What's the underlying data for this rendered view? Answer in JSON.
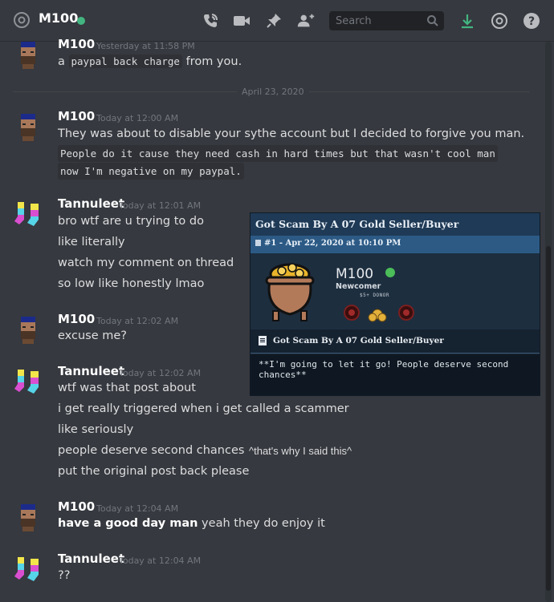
{
  "header": {
    "channel": "M100",
    "search_placeholder": "Search",
    "icons": [
      "at-sign-icon",
      "phone-call-icon",
      "video-call-icon",
      "pin-icon",
      "add-member-icon",
      "search-icon",
      "download-icon",
      "mentions-icon",
      "help-icon"
    ]
  },
  "divider": {
    "label": "April 23, 2020"
  },
  "messages": [
    {
      "author": "M100",
      "timestamp": "Yesterday at 11:58 PM",
      "lines": [
        "a ",
        "paypal back charge",
        " from you."
      ]
    },
    {
      "author": "M100",
      "timestamp": "Today at 12:00 AM",
      "lines": [
        "They was about to disable your sythe account but I decided to forgive you man.",
        "People do it cause they need cash in hard times but that wasn't cool man",
        "now I'm negative on my paypal."
      ]
    },
    {
      "author": "Tannuleet",
      "timestamp": "Today at 12:01 AM",
      "lines": [
        "bro wtf are u trying to do",
        "like literally",
        "watch my comment on thread",
        "so low like honestly lmao"
      ]
    },
    {
      "author": "M100",
      "timestamp": "Today at 12:02 AM",
      "lines": [
        "excuse me?"
      ]
    },
    {
      "author": "Tannuleet",
      "timestamp": "Today at 12:02 AM",
      "lines": [
        "wtf was that post about",
        "i get really triggered when i get called a scammer",
        "like seriously",
        "people deserve second chances",
        "put the original post back please"
      ]
    },
    {
      "author": "M100",
      "timestamp": "Today at 12:04 AM",
      "bold": "have a good day man",
      "rest": " yeah they do enjoy it"
    },
    {
      "author": "Tannuleet",
      "timestamp": "Today at 12:04 AM",
      "lines": [
        "??"
      ]
    }
  ],
  "embed": {
    "title": "Got Scam By A 07 Gold Seller/Buyer",
    "post": "#1 - Apr 22, 2020 at 10:10 PM",
    "user": "M100",
    "rank": "Newcomer",
    "badge": "$5+ DONOR",
    "subtitle": "Got Scam By A 07 Gold Seller/Buyer",
    "quote": "**I'm going to let it go! People deserve second chances**"
  },
  "annotation": "^that's why I said this^",
  "colors": {
    "background": "#36393f",
    "online": "#43b581",
    "download": "#43b581"
  }
}
